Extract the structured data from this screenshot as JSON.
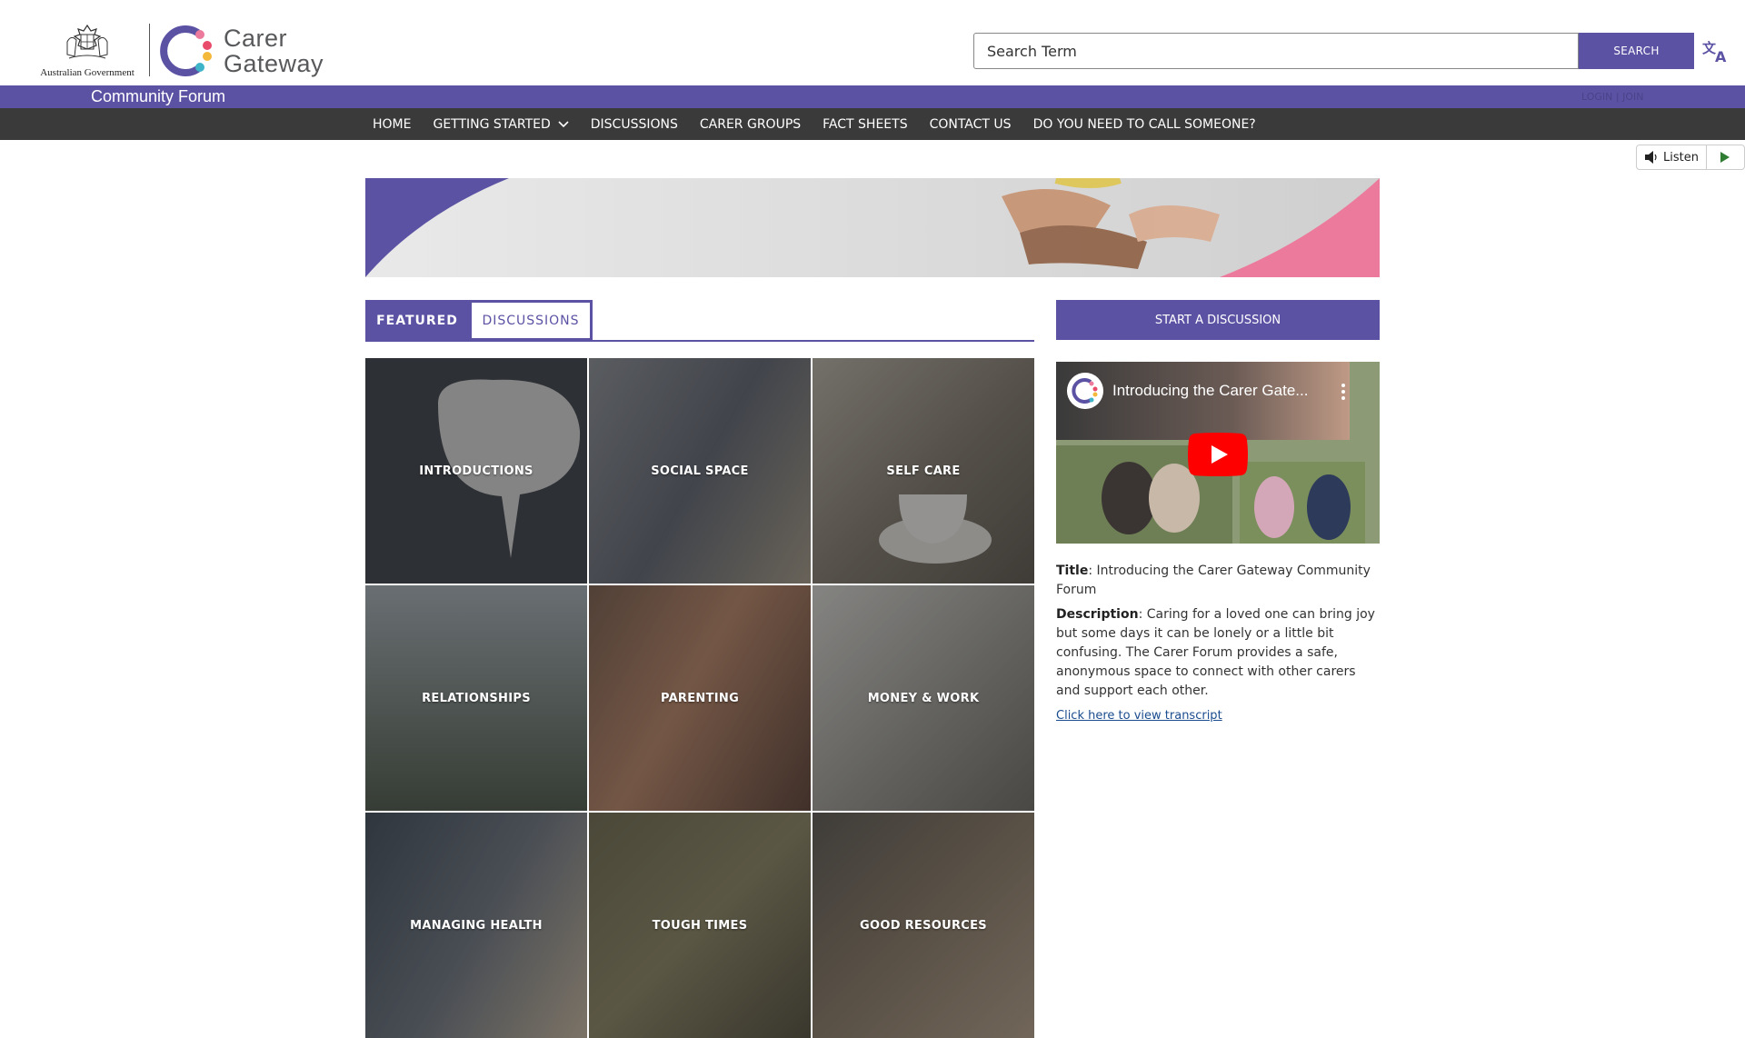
{
  "header": {
    "gov_text": "Australian Government",
    "logo_word_1": "Carer",
    "logo_word_2": "Gateway",
    "search_placeholder": "Search Term",
    "search_button": "SEARCH",
    "translate_icon": "translate-icon"
  },
  "forum_bar": {
    "title": "Community Forum",
    "login": "LOGIN | JOIN"
  },
  "nav": {
    "items": [
      {
        "label": "HOME"
      },
      {
        "label": "GETTING STARTED",
        "has_dropdown": true
      },
      {
        "label": "DISCUSSIONS"
      },
      {
        "label": "CARER GROUPS"
      },
      {
        "label": "FACT SHEETS"
      },
      {
        "label": "CONTACT US"
      },
      {
        "label": "DO YOU NEED TO CALL SOMEONE?"
      }
    ]
  },
  "listen": {
    "label": "Listen"
  },
  "tabs": {
    "featured": "FEATURED",
    "discussions": "DISCUSSIONS",
    "active": "featured"
  },
  "tiles": [
    {
      "label": "INTRODUCTIONS"
    },
    {
      "label": "SOCIAL SPACE"
    },
    {
      "label": "SELF CARE"
    },
    {
      "label": "RELATIONSHIPS"
    },
    {
      "label": "PARENTING"
    },
    {
      "label": "MONEY & WORK"
    },
    {
      "label": "MANAGING HEALTH"
    },
    {
      "label": "TOUGH TIMES"
    },
    {
      "label": "GOOD RESOURCES"
    }
  ],
  "sidebar": {
    "start_button": "START A DISCUSSION",
    "video_title": "Introducing the Carer Gate...",
    "title_label": "Title",
    "title_value": ": Introducing the Carer Gateway Community Forum",
    "description_label": "Description",
    "description_value": ": Caring for a loved one can bring joy but some days it can be lonely or a little bit confusing. The Carer Forum provides a safe, anonymous space to connect with other carers and support each other.",
    "transcript_link": "Click here to view transcript"
  },
  "colors": {
    "brand_purple": "#5b52a4",
    "nav_dark": "#3a3a3a",
    "accent_pink": "#ec7a9c",
    "link_blue": "#1a4c8f"
  }
}
